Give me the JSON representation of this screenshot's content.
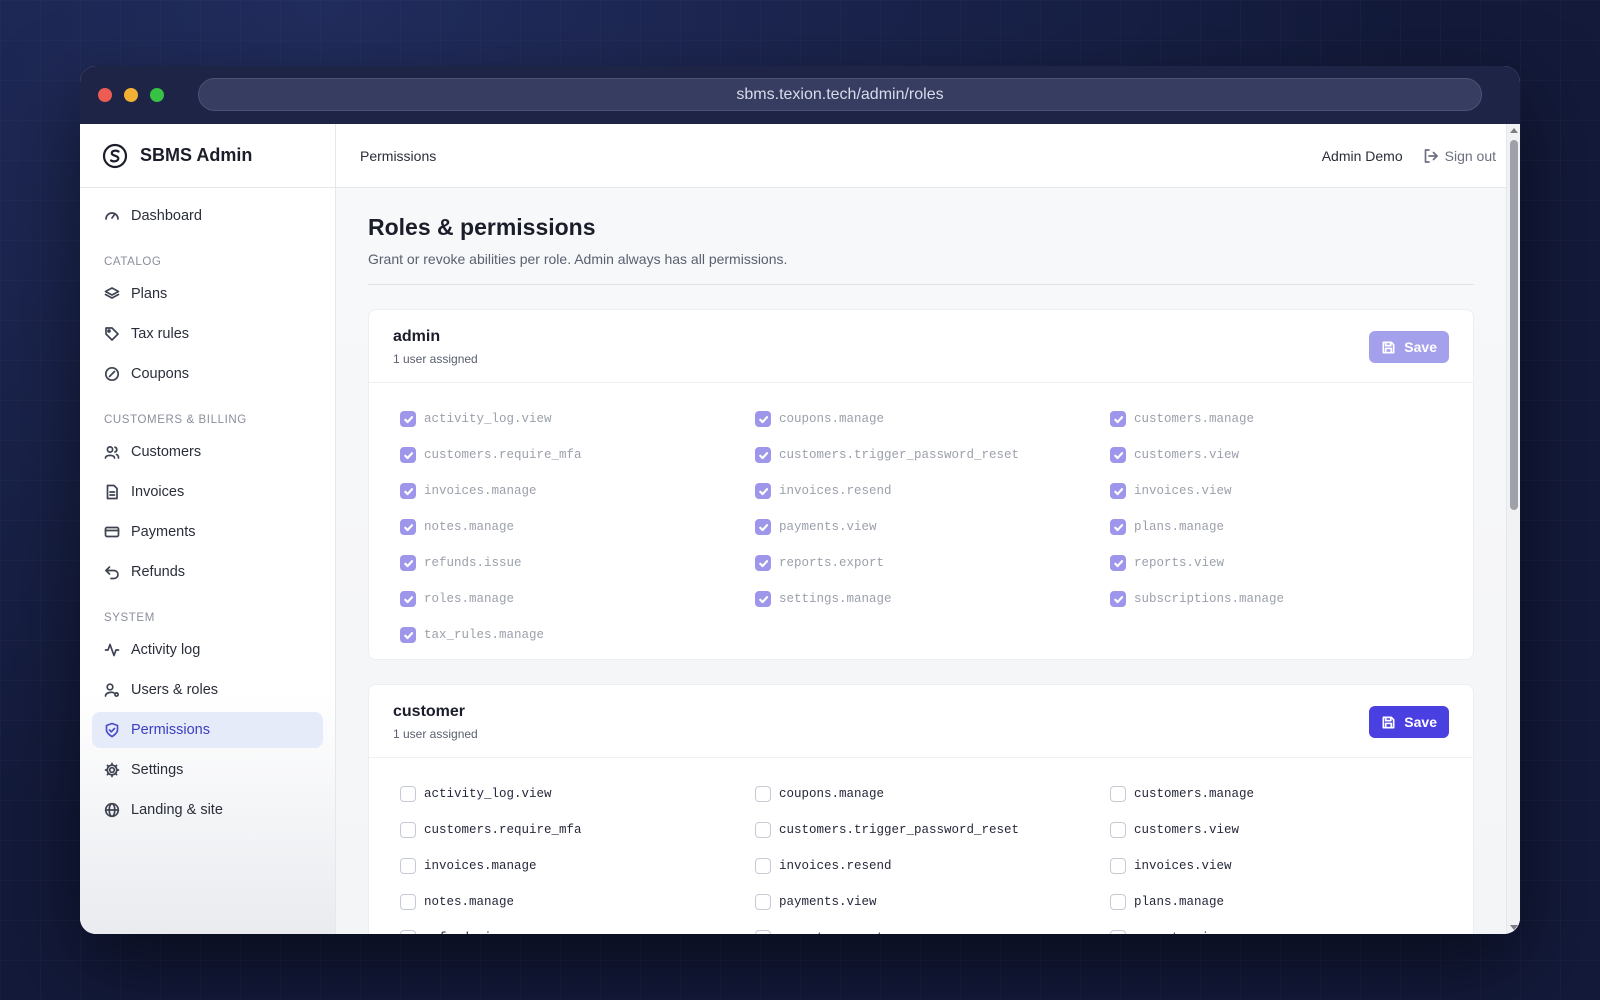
{
  "browser": {
    "url": "sbms.texion.tech/admin/roles"
  },
  "sidebar": {
    "brand": "SBMS Admin",
    "dashboard": "Dashboard",
    "sections": {
      "catalog": "CATALOG",
      "billing": "CUSTOMERS & BILLING",
      "system": "SYSTEM"
    },
    "items": {
      "plans": "Plans",
      "tax_rules": "Tax rules",
      "coupons": "Coupons",
      "customers": "Customers",
      "invoices": "Invoices",
      "payments": "Payments",
      "refunds": "Refunds",
      "activity_log": "Activity log",
      "users_roles": "Users & roles",
      "permissions": "Permissions",
      "settings": "Settings",
      "landing": "Landing & site"
    },
    "active_item": "Permissions"
  },
  "topbar": {
    "breadcrumb": "Permissions",
    "user_name": "Admin Demo",
    "sign_out": "Sign out"
  },
  "page": {
    "title": "Roles & permissions",
    "subtitle": "Grant or revoke abilities per role. Admin always has all permissions."
  },
  "roles": [
    {
      "name": "admin",
      "users": "1 user assigned",
      "save_label": "Save",
      "save_disabled": true,
      "permissions": [
        {
          "key": "activity_log.view",
          "checked": true
        },
        {
          "key": "coupons.manage",
          "checked": true
        },
        {
          "key": "customers.manage",
          "checked": true
        },
        {
          "key": "customers.require_mfa",
          "checked": true
        },
        {
          "key": "customers.trigger_password_reset",
          "checked": true
        },
        {
          "key": "customers.view",
          "checked": true
        },
        {
          "key": "invoices.manage",
          "checked": true
        },
        {
          "key": "invoices.resend",
          "checked": true
        },
        {
          "key": "invoices.view",
          "checked": true
        },
        {
          "key": "notes.manage",
          "checked": true
        },
        {
          "key": "payments.view",
          "checked": true
        },
        {
          "key": "plans.manage",
          "checked": true
        },
        {
          "key": "refunds.issue",
          "checked": true
        },
        {
          "key": "reports.export",
          "checked": true
        },
        {
          "key": "reports.view",
          "checked": true
        },
        {
          "key": "roles.manage",
          "checked": true
        },
        {
          "key": "settings.manage",
          "checked": true
        },
        {
          "key": "subscriptions.manage",
          "checked": true
        },
        {
          "key": "tax_rules.manage",
          "checked": true
        }
      ]
    },
    {
      "name": "customer",
      "users": "1 user assigned",
      "save_label": "Save",
      "save_disabled": false,
      "permissions": [
        {
          "key": "activity_log.view",
          "checked": false
        },
        {
          "key": "coupons.manage",
          "checked": false
        },
        {
          "key": "customers.manage",
          "checked": false
        },
        {
          "key": "customers.require_mfa",
          "checked": false
        },
        {
          "key": "customers.trigger_password_reset",
          "checked": false
        },
        {
          "key": "customers.view",
          "checked": false
        },
        {
          "key": "invoices.manage",
          "checked": false
        },
        {
          "key": "invoices.resend",
          "checked": false
        },
        {
          "key": "invoices.view",
          "checked": false
        },
        {
          "key": "notes.manage",
          "checked": false
        },
        {
          "key": "payments.view",
          "checked": false
        },
        {
          "key": "plans.manage",
          "checked": false
        },
        {
          "key": "refunds.issue",
          "checked": false
        },
        {
          "key": "reports.export",
          "checked": false
        },
        {
          "key": "reports.view",
          "checked": false
        }
      ]
    }
  ],
  "colors": {
    "accent": "#4a3fe0",
    "accent_disabled": "#a5a0ec",
    "active_nav_bg": "#e6ebfa",
    "titlebar": "#1d2446"
  }
}
